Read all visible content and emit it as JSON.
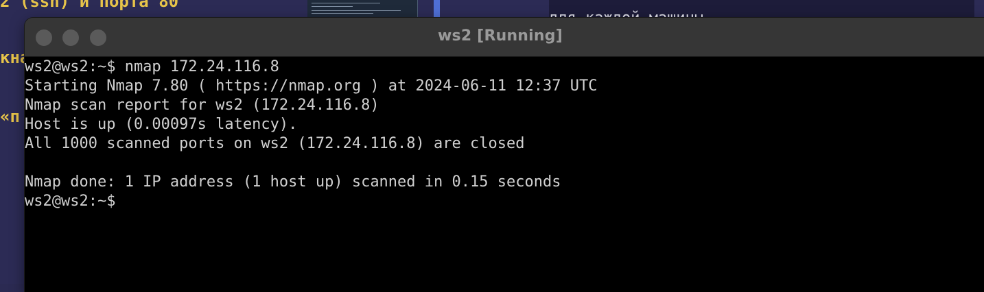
{
  "background": {
    "left_text_lines": [
      "2 (ssh) и порта 80",
      "кна",
      "«п"
    ],
    "right_text": "для каждой машины"
  },
  "window": {
    "title": "ws2 [Running]"
  },
  "terminal": {
    "lines": [
      "ws2@ws2:~$ nmap 172.24.116.8",
      "Starting Nmap 7.80 ( https://nmap.org ) at 2024-06-11 12:37 UTC",
      "Nmap scan report for ws2 (172.24.116.8)",
      "Host is up (0.00097s latency).",
      "All 1000 scanned ports on ws2 (172.24.116.8) are closed",
      "",
      "Nmap done: 1 IP address (1 host up) scanned in 0.15 seconds",
      "ws2@ws2:~$"
    ]
  },
  "colors": {
    "desktop": "#2c2b55",
    "background_text": "#e7c44a",
    "titlebar": "#363636",
    "title_text": "#9a9a9a",
    "terminal_bg": "#000000",
    "terminal_text": "#d0d0d0"
  },
  "icons": [
    "close-button",
    "minimize-button",
    "zoom-button"
  ]
}
